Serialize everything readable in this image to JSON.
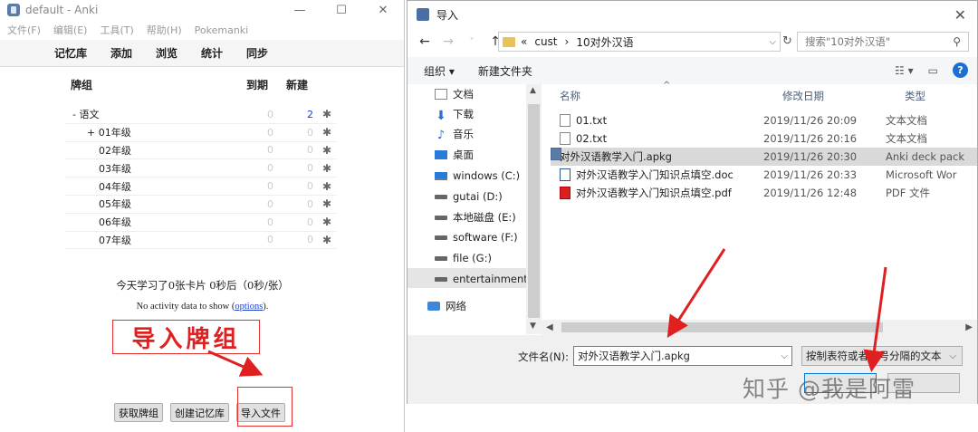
{
  "anki": {
    "title": "default - Anki",
    "menu": [
      "文件(F)",
      "编辑(E)",
      "工具(T)",
      "帮助(H)",
      "Pokemanki"
    ],
    "toolbar": [
      "记忆库",
      "添加",
      "浏览",
      "统计",
      "同步"
    ],
    "deck_header": {
      "name": "牌组",
      "due": "到期",
      "new": "新建"
    },
    "decks": [
      {
        "name": "-  语文",
        "due": "0",
        "new": "2"
      },
      {
        "name": "+  01年级",
        "due": "0",
        "new": "0"
      },
      {
        "name": "02年级",
        "due": "0",
        "new": "0"
      },
      {
        "name": "03年级",
        "due": "0",
        "new": "0"
      },
      {
        "name": "04年级",
        "due": "0",
        "new": "0"
      },
      {
        "name": "05年级",
        "due": "0",
        "new": "0"
      },
      {
        "name": "06年级",
        "due": "0",
        "new": "0"
      },
      {
        "name": "07年级",
        "due": "0",
        "new": "0"
      }
    ],
    "study_message": "今天学习了0张卡片 0秒后（0秒/张）",
    "no_activity_prefix": "No activity data to show (",
    "no_activity_link": "options",
    "no_activity_suffix": ").",
    "annotation": "导入牌组",
    "buttons": {
      "get_shared": "获取牌组",
      "create_deck": "创建记忆库",
      "import_file": "导入文件"
    }
  },
  "dialog": {
    "title": "导入",
    "breadcrumb": [
      "«",
      "cust",
      "›",
      "10对外汉语"
    ],
    "search_placeholder": "搜索\"10对外汉语\"",
    "organize": "组织 ▾",
    "new_folder": "新建文件夹",
    "nav": [
      {
        "label": "文档",
        "icon": "document-icon"
      },
      {
        "label": "下载",
        "icon": "download-icon"
      },
      {
        "label": "音乐",
        "icon": "music-icon"
      },
      {
        "label": "桌面",
        "icon": "desktop-icon"
      },
      {
        "label": "windows (C:)",
        "icon": "windows-drive-icon"
      },
      {
        "label": "gutai (D:)",
        "icon": "drive-icon"
      },
      {
        "label": "本地磁盘 (E:)",
        "icon": "drive-icon"
      },
      {
        "label": "software (F:)",
        "icon": "drive-icon"
      },
      {
        "label": "file (G:)",
        "icon": "drive-icon"
      },
      {
        "label": "entertainment (",
        "icon": "drive-icon"
      },
      {
        "label": "网络",
        "icon": "network-icon"
      }
    ],
    "columns": {
      "name": "名称",
      "date": "修改日期",
      "type": "类型"
    },
    "files": [
      {
        "name": "01.txt",
        "date": "2019/11/26 20:09",
        "type": "文本文档",
        "icon": "text-file-icon"
      },
      {
        "name": "02.txt",
        "date": "2019/11/26 20:16",
        "type": "文本文档",
        "icon": "text-file-icon"
      },
      {
        "name": "对外汉语教学入门.apkg",
        "date": "2019/11/26 20:30",
        "type": "Anki deck pack",
        "icon": "anki-file-icon"
      },
      {
        "name": "对外汉语教学入门知识点填空.doc",
        "date": "2019/11/26 20:33",
        "type": "Microsoft Wor",
        "icon": "word-file-icon"
      },
      {
        "name": "对外汉语教学入门知识点填空.pdf",
        "date": "2019/11/26 12:48",
        "type": "PDF 文件",
        "icon": "pdf-file-icon"
      }
    ],
    "filename_label": "文件名(N):",
    "filename_value": "对外汉语教学入门.apkg",
    "filter_value": "按制表符或者分号分隔的文本"
  },
  "watermark": "知乎 @我是阿雷",
  "colors": {
    "annotation_red": "#e02020",
    "selection": "#d9d9d9",
    "accent_blue": "#0078d7"
  }
}
